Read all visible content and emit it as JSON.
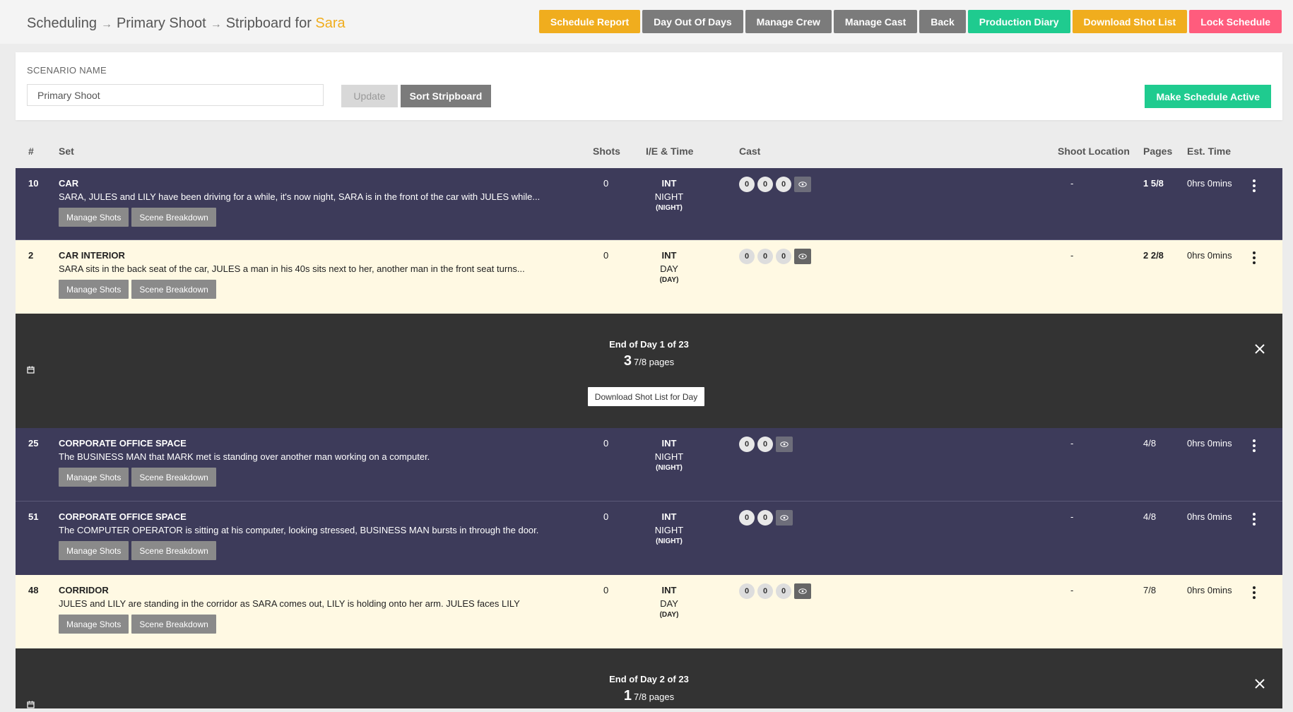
{
  "header": {
    "crumb1": "Scheduling",
    "crumb2": "Primary Shoot",
    "crumb3": "Stripboard for",
    "project": "Sara",
    "buttons": [
      {
        "label": "Schedule Report"
      },
      {
        "label": "Day Out Of Days"
      },
      {
        "label": "Manage Crew"
      },
      {
        "label": "Manage Cast"
      },
      {
        "label": "Back"
      },
      {
        "label": "Production Diary"
      },
      {
        "label": "Download Shot List"
      },
      {
        "label": "Lock Schedule"
      }
    ]
  },
  "scenario": {
    "label": "SCENARIO NAME",
    "value": "Primary Shoot",
    "update": "Update",
    "sort": "Sort Stripboard",
    "make_active": "Make Schedule Active"
  },
  "table_headers": {
    "num": "#",
    "set": "Set",
    "shots": "Shots",
    "ie_time": "I/E & Time",
    "cast": "Cast",
    "location": "Shoot Location",
    "pages": "Pages",
    "est": "Est. Time"
  },
  "row_buttons": {
    "manage": "Manage Shots",
    "breakdown": "Scene Breakdown"
  },
  "rows": [
    {
      "num": "10",
      "title": "CAR",
      "desc": "SARA, JULES and LILY have been driving for a while, it's now night, SARA is in the front of the car with JULES while...",
      "shots": "0",
      "ie": "INT",
      "tod": "NIGHT",
      "tod2": "(NIGHT)",
      "cast": [
        "0",
        "0",
        "0"
      ],
      "location": "-",
      "pages": "1 5/8",
      "est": "0hrs 0mins"
    },
    {
      "num": "2",
      "title": "CAR INTERIOR",
      "desc": "SARA sits in the back seat of the car, JULES a man in his 40s sits next to her, another man in the front seat turns...",
      "shots": "0",
      "ie": "INT",
      "tod": "DAY",
      "tod2": "(DAY)",
      "cast": [
        "0",
        "0",
        "0"
      ],
      "location": "-",
      "pages": "2 2/8",
      "est": "0hrs 0mins"
    },
    {
      "num": "25",
      "title": "CORPORATE OFFICE SPACE",
      "desc": "The BUSINESS MAN that MARK met is standing over another man working on a computer.",
      "shots": "0",
      "ie": "INT",
      "tod": "NIGHT",
      "tod2": "(NIGHT)",
      "cast": [
        "0",
        "0"
      ],
      "location": "-",
      "pages": "4/8",
      "est": "0hrs 0mins"
    },
    {
      "num": "51",
      "title": "CORPORATE OFFICE SPACE",
      "desc": "The COMPUTER OPERATOR is sitting at his computer, looking stressed, BUSINESS MAN bursts in through the door.",
      "shots": "0",
      "ie": "INT",
      "tod": "NIGHT",
      "tod2": "(NIGHT)",
      "cast": [
        "0",
        "0"
      ],
      "location": "-",
      "pages": "4/8",
      "est": "0hrs 0mins"
    },
    {
      "num": "48",
      "title": "CORRIDOR",
      "desc": "JULES and LILY are standing in the corridor as SARA comes out, LILY is holding onto her arm. JULES faces LILY",
      "shots": "0",
      "ie": "INT",
      "tod": "DAY",
      "tod2": "(DAY)",
      "cast": [
        "0",
        "0",
        "0"
      ],
      "location": "-",
      "pages": "7/8",
      "est": "0hrs 0mins"
    }
  ],
  "days": [
    {
      "title": "End of Day 1 of 23",
      "pages_whole": "3",
      "pages_rest": "7/8 pages",
      "download": "Download Shot List for Day"
    },
    {
      "title": "End of Day 2 of 23",
      "pages_whole": "1",
      "pages_rest": "7/8 pages"
    }
  ]
}
